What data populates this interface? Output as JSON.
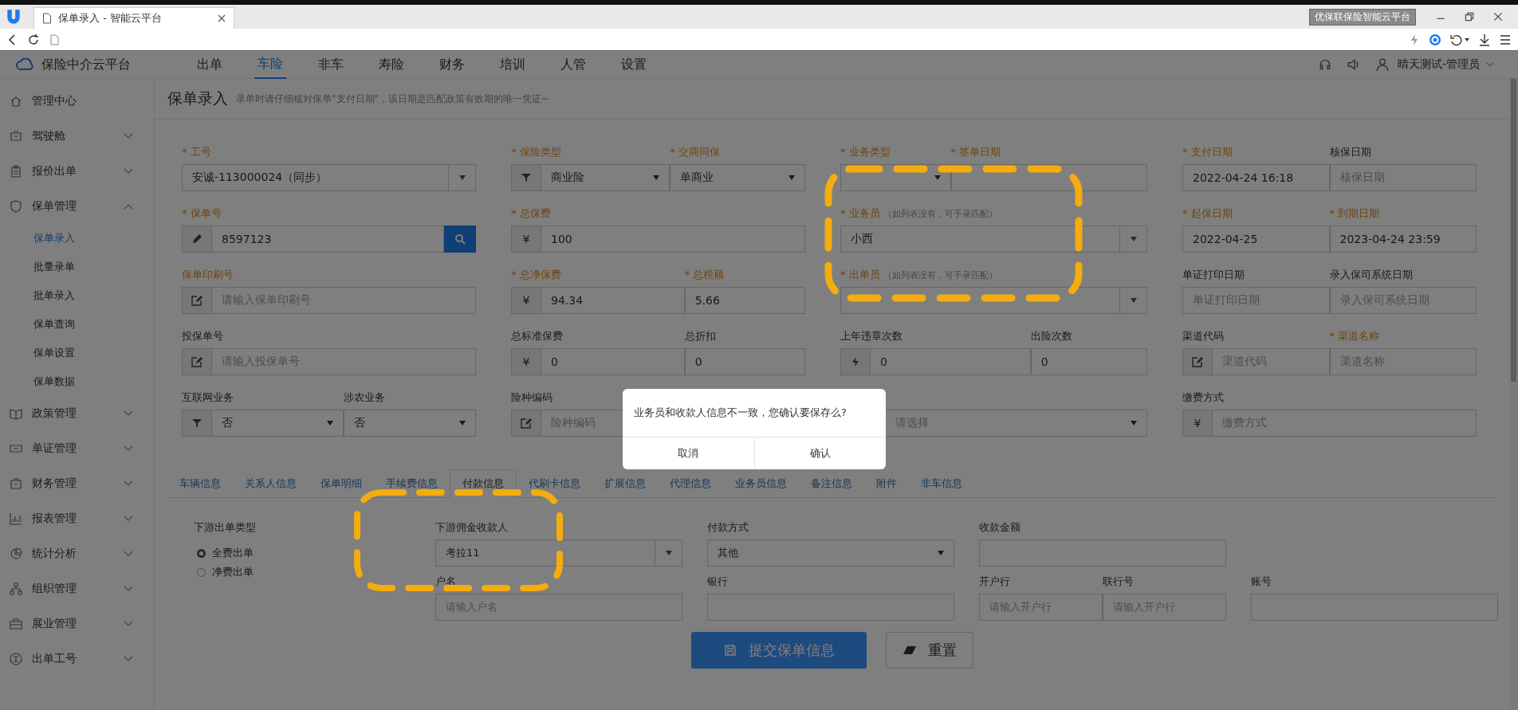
{
  "browser": {
    "tabs": [
      {
        "title": "保单录入 - 智能云平台",
        "selected": true
      }
    ],
    "site_label": "优保联保险智能云平台"
  },
  "header": {
    "brand": "保险中介云平台",
    "nav": [
      {
        "label": "出单",
        "selected": false
      },
      {
        "label": "车险",
        "selected": true
      },
      {
        "label": "非车",
        "selected": false
      },
      {
        "label": "寿险",
        "selected": false
      },
      {
        "label": "财务",
        "selected": false
      },
      {
        "label": "培训",
        "selected": false
      },
      {
        "label": "人管",
        "selected": false
      },
      {
        "label": "设置",
        "selected": false
      }
    ],
    "user": "晴天测试-管理员"
  },
  "sidebar": {
    "items": [
      {
        "label": "管理中心"
      },
      {
        "label": "驾驶舱",
        "expanded": false
      },
      {
        "label": "报价出单",
        "expanded": false
      },
      {
        "label": "保单管理",
        "expanded": true,
        "children": [
          {
            "label": "保单录入",
            "selected": true
          },
          {
            "label": "批量录单",
            "selected": false
          },
          {
            "label": "批单录入",
            "selected": false
          },
          {
            "label": "保单查询",
            "selected": false
          },
          {
            "label": "保单设置",
            "selected": false
          },
          {
            "label": "保单数据",
            "selected": false
          }
        ]
      },
      {
        "label": "政策管理",
        "expanded": false
      },
      {
        "label": "单证管理",
        "expanded": false
      },
      {
        "label": "财务管理",
        "expanded": false
      },
      {
        "label": "报表管理",
        "expanded": false
      },
      {
        "label": "统计分析",
        "expanded": false
      },
      {
        "label": "组织管理",
        "expanded": false
      },
      {
        "label": "展业管理",
        "expanded": false
      },
      {
        "label": "出单工号",
        "expanded": false
      }
    ]
  },
  "page": {
    "title": "保单录入",
    "notice": "录单时请仔细核对保单\"支付日期\"，该日期是匹配政策有效期的唯一凭证~"
  },
  "form": {
    "rows": [
      [
        {
          "fields": [
            {
              "label": "* 工号",
              "highlighted": true,
              "kind": "combo",
              "value": "安诚-113000024（同步）"
            }
          ]
        },
        {
          "fields": [
            {
              "label": "* 保险类型",
              "highlighted": true,
              "kind": "filterselect",
              "value": "商业险"
            },
            {
              "label": "* 交商同保",
              "highlighted": true,
              "kind": "select",
              "value": "单商业"
            }
          ]
        },
        {
          "fields": [
            {
              "label": "* 业务类型",
              "highlighted": true,
              "kind": "select"
            },
            {
              "label": "* 签单日期",
              "highlighted": true,
              "kind": "input"
            }
          ]
        },
        {
          "fields": [
            {
              "label": "* 支付日期",
              "highlighted": true,
              "kind": "input",
              "value": "2022-04-24 16:18"
            },
            {
              "label": "核保日期",
              "highlighted": false,
              "kind": "input",
              "placeholder": "核保日期"
            }
          ]
        }
      ],
      [
        {
          "fields": [
            {
              "label": "* 保单号",
              "highlighted": true,
              "kind": "pencilsearch",
              "value": "8597123"
            }
          ]
        },
        {
          "fields": [
            {
              "label": "* 总保费",
              "highlighted": true,
              "kind": "moneyinput",
              "addon": "¥",
              "value": "100"
            }
          ]
        },
        {
          "fields": [
            {
              "label": "* 业务员",
              "highlighted": true,
              "hint": "（如列表没有，可手录匹配）",
              "kind": "combo",
              "value": "小西"
            }
          ]
        },
        {
          "fields": [
            {
              "label": "* 起保日期",
              "highlighted": true,
              "kind": "input",
              "value": "2022-04-25"
            },
            {
              "label": "* 到期日期",
              "highlighted": true,
              "kind": "input",
              "value": "2023-04-24 23:59"
            }
          ]
        }
      ],
      [
        {
          "fields": [
            {
              "label": "保单印刷号",
              "highlighted": true,
              "kind": "editinput",
              "placeholder": "请输入保单印刷号"
            }
          ]
        },
        {
          "fields": [
            {
              "label": "* 总净保费",
              "highlighted": true,
              "kind": "moneyinput",
              "addon": "¥",
              "value": "94.34"
            },
            {
              "label": "* 总税额",
              "highlighted": true,
              "kind": "input",
              "value": "5.66"
            }
          ]
        },
        {
          "fields": [
            {
              "label": "* 出单员",
              "highlighted": true,
              "hint": "（如列表没有，可手录匹配）",
              "kind": "combo"
            }
          ]
        },
        {
          "fields": [
            {
              "label": "单证打印日期",
              "highlighted": false,
              "kind": "input",
              "placeholder": "单证打印日期"
            },
            {
              "label": "录入保司系统日期",
              "highlighted": false,
              "kind": "input",
              "placeholder": "录入保司系统日期"
            }
          ]
        }
      ],
      [
        {
          "fields": [
            {
              "label": "投保单号",
              "highlighted": false,
              "kind": "editinput",
              "placeholder": "请输入投保单号"
            }
          ]
        },
        {
          "fields": [
            {
              "label": "总标准保费",
              "highlighted": false,
              "kind": "moneyinput",
              "addon": "¥",
              "value": "0"
            },
            {
              "label": "总折扣",
              "highlighted": false,
              "kind": "input",
              "value": "0"
            }
          ]
        },
        {
          "fields": [
            {
              "label": "上年违章次数",
              "highlighted": false,
              "kind": "boltinput",
              "value": "0"
            },
            {
              "label": "出险次数",
              "highlighted": false,
              "kind": "input",
              "value": "0"
            }
          ]
        },
        {
          "fields": [
            {
              "label": "渠道代码",
              "highlighted": false,
              "kind": "editinput",
              "placeholder": "渠道代码"
            },
            {
              "label": "* 渠道名称",
              "highlighted": true,
              "kind": "input",
              "placeholder": "渠道名称"
            }
          ]
        }
      ],
      [
        {
          "fields": [
            {
              "label": "互联网业务",
              "highlighted": false,
              "kind": "filterselect",
              "value": "否"
            },
            {
              "label": "涉农业务",
              "highlighted": false,
              "kind": "select",
              "value": "否"
            }
          ]
        },
        {
          "fields": [
            {
              "label": "险种编码",
              "highlighted": false,
              "kind": "editinput",
              "placeholder": "险种编码"
            }
          ]
        },
        {
          "fields": [
            {
              "kind": "select",
              "placeholder": "请选择"
            }
          ]
        },
        {
          "fields": [
            {
              "label": "缴费方式",
              "highlighted": false,
              "kind": "moneyinput",
              "addon": "¥",
              "placeholder": "缴费方式"
            }
          ]
        }
      ]
    ]
  },
  "tabs": [
    {
      "label": "车辆信息",
      "selected": false
    },
    {
      "label": "关系人信息",
      "selected": false
    },
    {
      "label": "保单明细",
      "selected": false
    },
    {
      "label": "手续费信息",
      "selected": false
    },
    {
      "label": "付款信息",
      "selected": true
    },
    {
      "label": "代刷卡信息",
      "selected": false
    },
    {
      "label": "扩展信息",
      "selected": false
    },
    {
      "label": "代理信息",
      "selected": false
    },
    {
      "label": "业务员信息",
      "selected": false
    },
    {
      "label": "备注信息",
      "selected": false
    },
    {
      "label": "附件",
      "selected": false
    },
    {
      "label": "非车信息",
      "selected": false
    }
  ],
  "payment": {
    "type_label": "下游出单类型",
    "options": [
      {
        "label": "全费出单",
        "selected": true
      },
      {
        "label": "净费出单",
        "selected": false
      }
    ],
    "rows": [
      [
        {
          "fields": [
            {
              "label": "下游佣金收款人",
              "kind": "combo",
              "value": "考拉11"
            }
          ]
        },
        {
          "fields": [
            {
              "label": "付款方式",
              "kind": "select",
              "value": "其他"
            }
          ]
        },
        {
          "fields": [
            {
              "label": "收款金额",
              "kind": "input"
            }
          ]
        }
      ],
      [
        {
          "fields": [
            {
              "label": "户名",
              "kind": "input",
              "placeholder": "请输入户名"
            }
          ]
        },
        {
          "fields": [
            {
              "label": "银行",
              "kind": "input"
            }
          ]
        },
        {
          "fields": [
            {
              "label": "开户行",
              "kind": "input",
              "placeholder": "请输入开户行"
            },
            {
              "label": "联行号",
              "kind": "input",
              "placeholder": "请输入开户行"
            }
          ]
        },
        {
          "fields": [
            {
              "label": "账号",
              "kind": "input"
            }
          ]
        }
      ]
    ]
  },
  "actions": [
    {
      "label": "提交保单信息",
      "kind": "primary"
    },
    {
      "label": "重置",
      "kind": "default"
    }
  ],
  "dialog": {
    "message": "业务员和收款人信息不一致，您确认要保存么?",
    "buttons": [
      "取消",
      "确认"
    ]
  }
}
